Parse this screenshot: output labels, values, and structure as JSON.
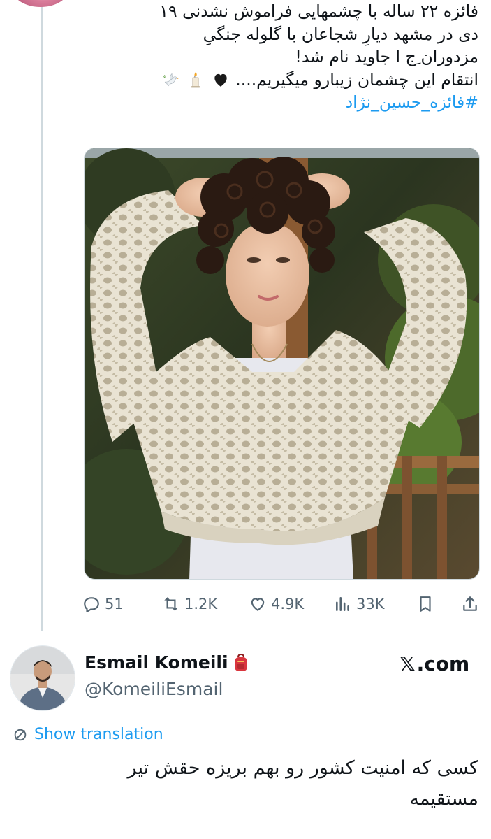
{
  "tweet": {
    "text_lines": [
      "فائزه ۲۲ ساله با چشمهایی فراموش نشدنی ۱۹",
      "دی در مشهد دیارِ شجاعان با گلوله جنگیِ",
      "مزدوران ِج ا جاوید نام شد!",
      "انتقام این چشمان زیبارو میگیریم...."
    ],
    "emojis": [
      "black-heart-icon",
      "candle-icon",
      "dove-icon"
    ],
    "hashtag": "#فائزه_حسین_نژاد",
    "image_alt": "Photo of a young woman with curly hair wearing a white crochet sweater",
    "actions": {
      "replies": "51",
      "reposts": "1.2K",
      "likes": "4.9K",
      "views": "33K"
    }
  },
  "reply": {
    "name": "Esmail Komeili",
    "name_emoji": "backpack-icon",
    "handle": "@KomeiliEsmail",
    "brand_x": "𝕏",
    "brand_suffix": ".com",
    "show_translation": "Show translation",
    "text_lines": [
      "کسی که امنیت کشور رو بهم بریزه حقش تیر",
      "مستقیمه"
    ]
  },
  "colors": {
    "text": "#0f1419",
    "muted": "#536471",
    "link": "#1d9bf0",
    "thread_line": "#cfd9de"
  }
}
